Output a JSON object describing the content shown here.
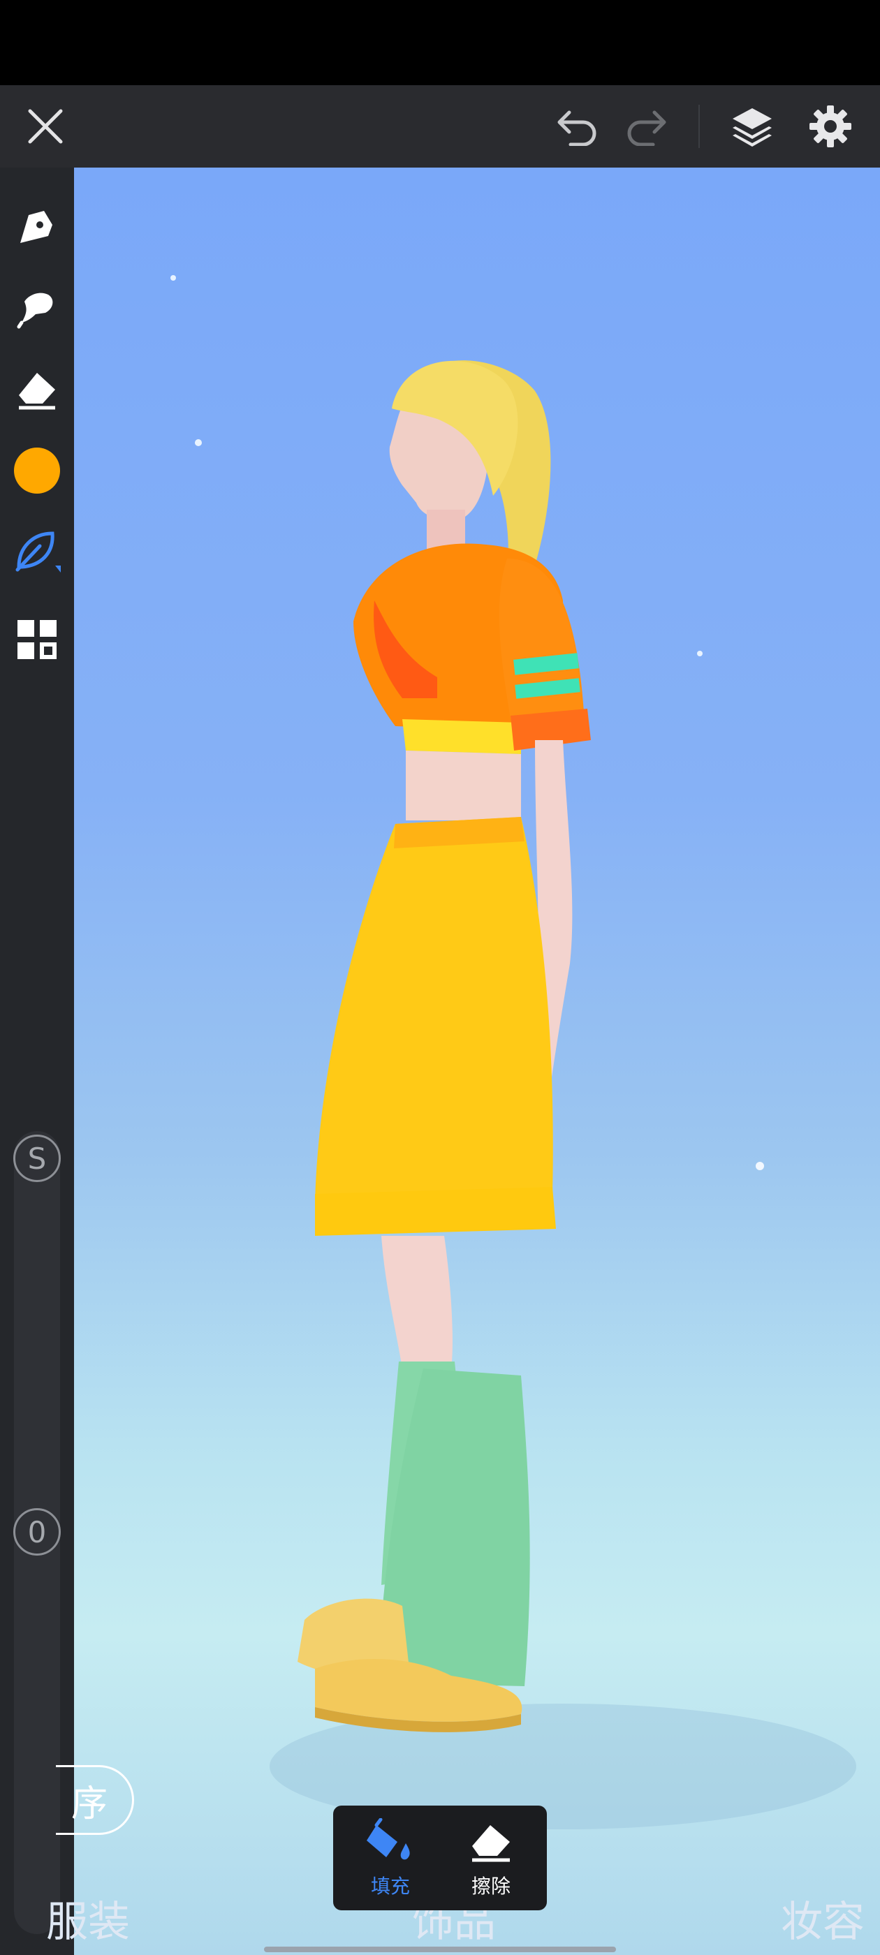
{
  "topbar": {
    "close_icon": "close-icon",
    "undo_icon": "undo-icon",
    "redo_icon": "redo-icon",
    "layers_icon": "layers-icon",
    "settings_icon": "gear-icon"
  },
  "sidebar": {
    "tools": [
      "pen-tool-icon",
      "smudge-brush-icon",
      "eraser-icon",
      "color-swatch",
      "leaf-brush-icon",
      "grid-pattern-icon"
    ],
    "selected_color": "#ffa800",
    "size_label": "S",
    "opacity_label": "0"
  },
  "bottom_tabs": {
    "left": "服装",
    "middle": "饰品",
    "right": "妆容"
  },
  "save_button_partial": "序",
  "tool_popup": {
    "fill_label": "填充",
    "erase_label": "擦除"
  },
  "colors": {
    "accent_blue": "#3e86f5",
    "topbar_bg": "#2a2b2f",
    "sidebar_bg": "#25272b"
  }
}
